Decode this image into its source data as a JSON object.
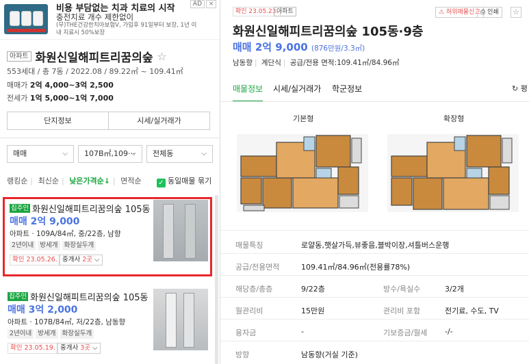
{
  "ad": {
    "title": "비용 부담없는 치과 치료의 시작",
    "subtitle": "충전치료 개수 제한없이",
    "desc": "(무)THE건강한치아보험V, 가입후 91일부터 보장, 1년 이내 지료시 50%보장",
    "badge": "AD",
    "close": "×"
  },
  "complex": {
    "type_tag": "아파트",
    "name": "화원신일해피트리꿈의숲",
    "star": "☆",
    "info": "553세대 / 총 7동 / 2022.08 / 89.22㎡ ~ 109.41㎡",
    "sale_label": "매매가",
    "sale_value": "2억 4,000~3억 2,500",
    "jeonse_label": "전세가",
    "jeonse_value": "1억 5,000~1억 7,000",
    "btn_info": "단지정보",
    "btn_price": "시세/실거래가"
  },
  "filters": {
    "trade": "매매",
    "area": "107B㎡,109···",
    "dong": "전체동"
  },
  "sort": {
    "items": [
      "랭킹순",
      "최신순",
      "낮은가격순↓",
      "면적순"
    ],
    "same_listing": "동일매물 묶기"
  },
  "listings": [
    {
      "tag": "집주인",
      "name": "화원신일해피트리꿈의숲 105동",
      "price": "매매 2억 9,000",
      "detail": "아파트 · 109A/84㎡, 중/22층, 남향",
      "tags": [
        "2년이내",
        "방세개",
        "화장실두개"
      ],
      "confirm": "확인 23.05.26.",
      "agent_prefix": "중개사 ",
      "agent_count": "2곳",
      "agent_suffix": " ⌵"
    },
    {
      "tag": "집주인",
      "name": "화원신일해피트리꿈의숲 105동",
      "price": "매매 3억 2,000",
      "detail": "아파트 · 107B/84㎡, 저/22층, 남동향",
      "tags": [
        "2년이내",
        "방세개",
        "화장실두개"
      ],
      "confirm": "확인 23.05.19.",
      "agent_prefix": "중개사 ",
      "agent_count": "3곳",
      "agent_suffix": " ⌵"
    }
  ],
  "detail": {
    "confirm": "확인 23.05.23.",
    "type_tag": "아파트",
    "report": "허위매물신고",
    "print": "인쇄",
    "star": "☆",
    "title": "화원신일해피트리꿈의숲 105동·9층",
    "price": "매매 2억 9,000",
    "price_per": "(876만원/3.3㎡)",
    "meta": [
      "남동향",
      "계단식",
      "공급/전용 면적:109.41㎡/84.96㎡"
    ],
    "tabs": [
      "매물정보",
      "시세/실거래가",
      "학군정보"
    ],
    "refresh": "평",
    "plan_basic": "기본형",
    "plan_ext": "확장형",
    "specs": {
      "feature_label": "매물특징",
      "feature_value": "로얄동,햇살가득,뷰좋음,블박이장,셔틀버스운행",
      "area_label": "공급/전용면적",
      "area_value": "109.41㎡/84.96㎡(전용률78%)",
      "floor_label": "해당층/총층",
      "floor_value": "9/22층",
      "rooms_label": "방수/욕실수",
      "rooms_value": "3/2개",
      "fee_label": "월관리비",
      "fee_value": "15만원",
      "fee_inc_label": "관리비 포함",
      "fee_inc_value": "전기료, 수도, TV",
      "loan_label": "융자금",
      "loan_value": "-",
      "deposit_label": "기보증금/월세",
      "deposit_value": "-/-",
      "dir_label": "방향",
      "dir_value": "남동향(거실 기준)"
    }
  }
}
